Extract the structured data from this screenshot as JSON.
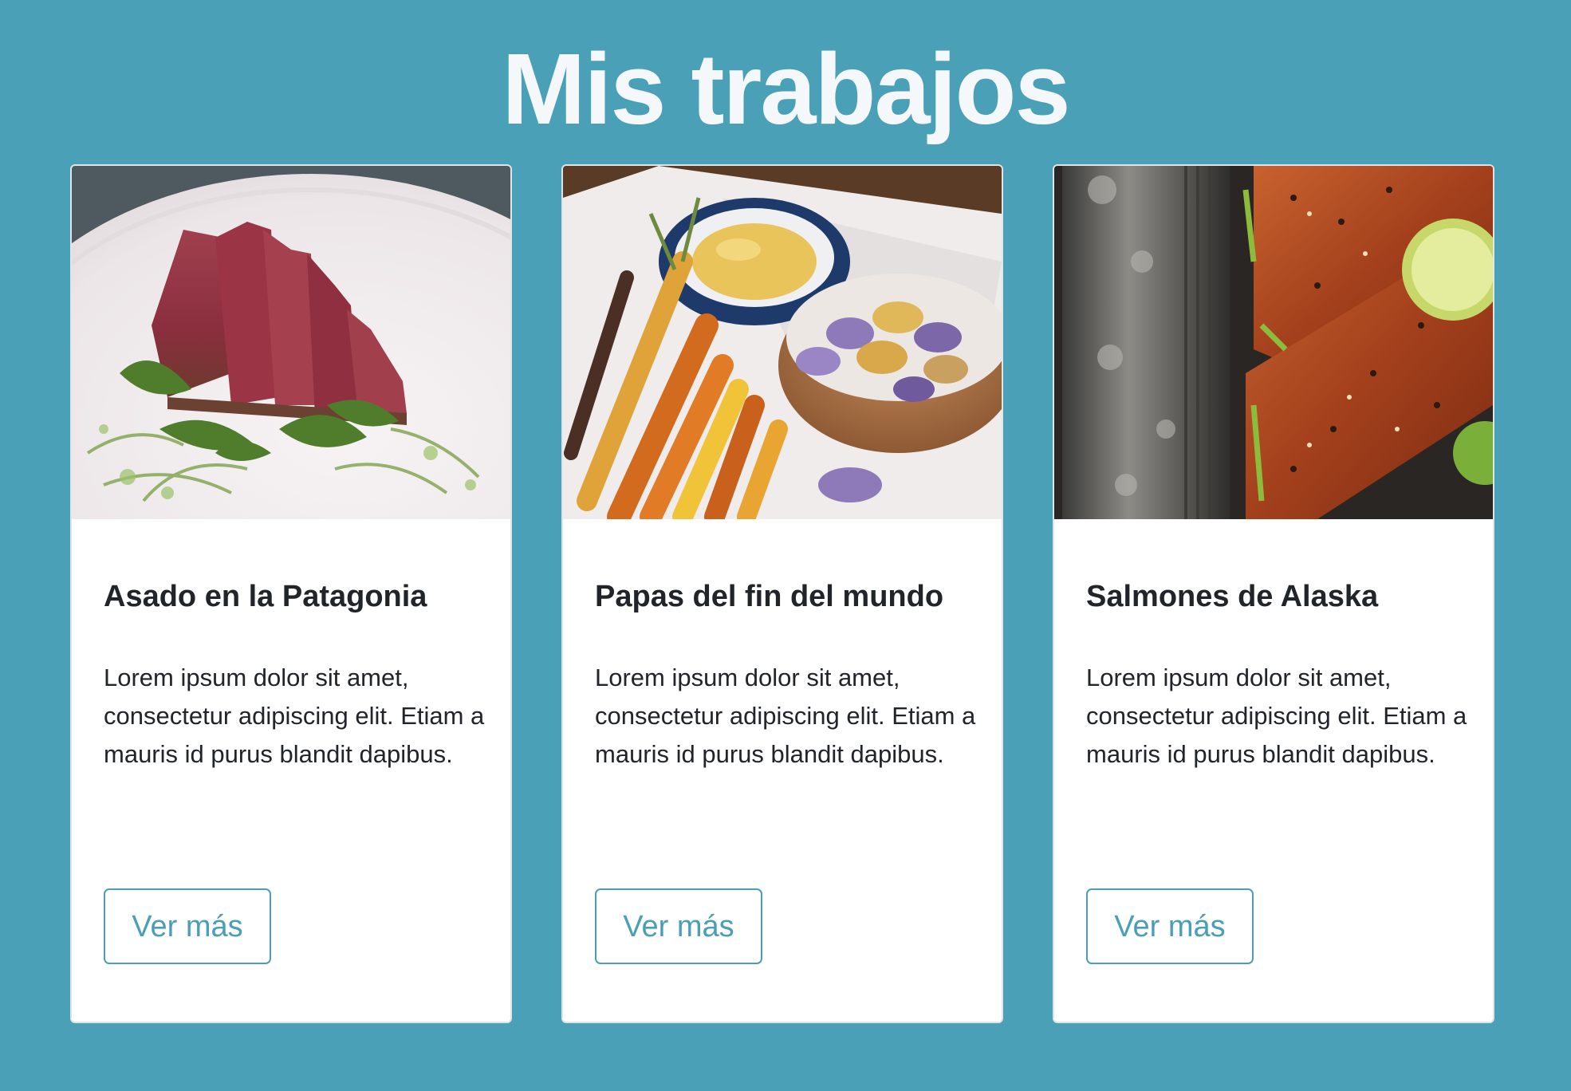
{
  "page": {
    "title": "Mis trabajos",
    "background_color": "#4aa0b6",
    "accent_color": "#4a9fb5"
  },
  "cards": [
    {
      "title": "Asado en la Patagonia",
      "text": "Lorem ipsum dolor sit amet, consectetur adipiscing elit. Etiam a mauris id purus blandit dapibus.",
      "button_label": "Ver más",
      "image_subject": "sliced seared tuna with arugula on white plate"
    },
    {
      "title": "Papas del fin del mundo",
      "text": "Lorem ipsum dolor sit amet, consectetur adipiscing elit. Etiam a mauris id purus blandit dapibus.",
      "button_label": "Ver más",
      "image_subject": "roasted carrots, potato chips and dip on parchment"
    },
    {
      "title": "Salmones de Alaska",
      "text": "Lorem ipsum dolor sit amet, consectetur adipiscing elit. Etiam a mauris id purus blandit dapibus.",
      "button_label": "Ver más",
      "image_subject": "glazed salmon with sesame and lime next to knife"
    }
  ]
}
